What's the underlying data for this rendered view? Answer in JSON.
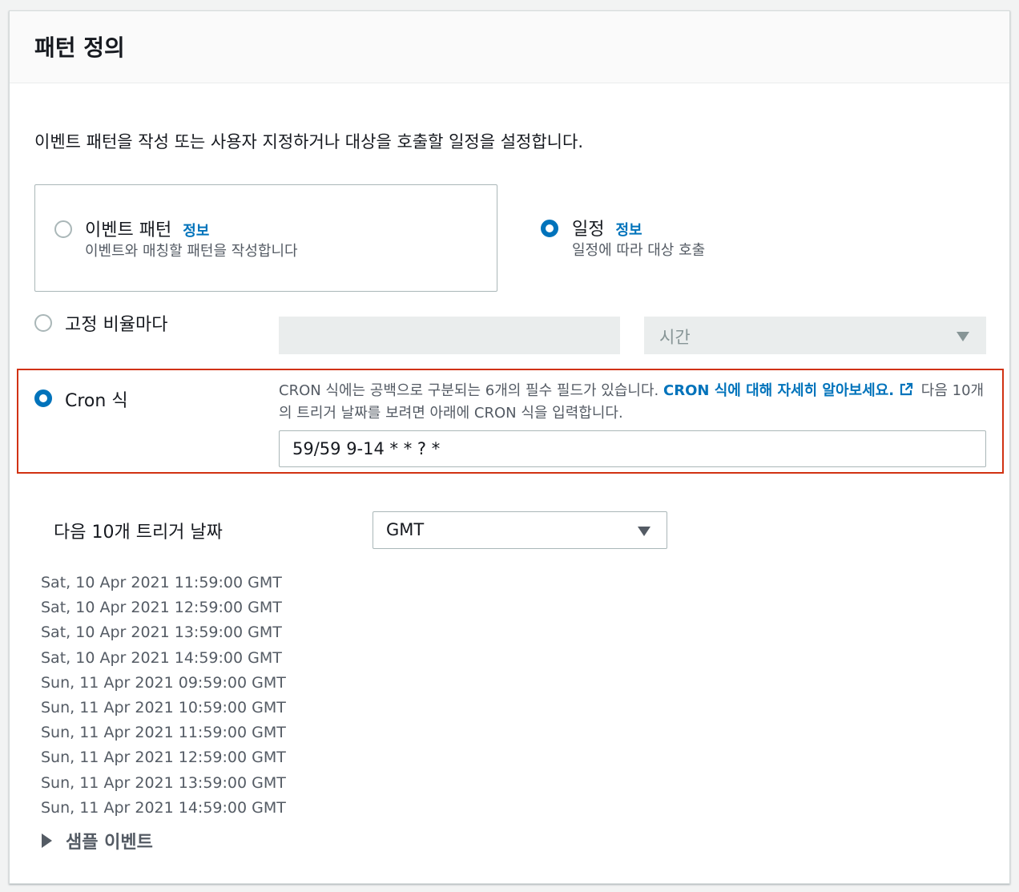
{
  "panel": {
    "title": "패턴 정의",
    "description": "이벤트 패턴을 작성 또는 사용자 지정하거나 대상을 호출할 일정을 설정합니다."
  },
  "pattern_type": {
    "event_pattern": {
      "label": "이벤트 패턴",
      "info": "정보",
      "description": "이벤트와 매칭할 패턴을 작성합니다",
      "selected": false
    },
    "schedule": {
      "label": "일정",
      "info": "정보",
      "description": "일정에 따라 대상 호출",
      "selected": true
    }
  },
  "fixed_rate": {
    "label": "고정 비율마다",
    "value": "",
    "unit_placeholder": "시간",
    "selected": false
  },
  "cron": {
    "label": "Cron 식",
    "selected": true,
    "help_prefix": "CRON 식에는 공백으로 구분되는 6개의 필수 필드가 있습니다.",
    "help_link": "CRON 식에 대해 자세히 알아보세요.",
    "help_suffix": "다음 10개의 트리거 날짜를 보려면 아래에 CRON 식을 입력합니다.",
    "expression": "59/59 9-14 * * ? *"
  },
  "next_triggers": {
    "label": "다음 10개 트리거 날짜",
    "timezone": "GMT",
    "dates": [
      "Sat, 10 Apr 2021 11:59:00 GMT",
      "Sat, 10 Apr 2021 12:59:00 GMT",
      "Sat, 10 Apr 2021 13:59:00 GMT",
      "Sat, 10 Apr 2021 14:59:00 GMT",
      "Sun, 11 Apr 2021 09:59:00 GMT",
      "Sun, 11 Apr 2021 10:59:00 GMT",
      "Sun, 11 Apr 2021 11:59:00 GMT",
      "Sun, 11 Apr 2021 12:59:00 GMT",
      "Sun, 11 Apr 2021 13:59:00 GMT",
      "Sun, 11 Apr 2021 14:59:00 GMT"
    ]
  },
  "sample_events": {
    "label": "샘플 이벤트",
    "expanded": false
  },
  "colors": {
    "accent": "#0073bb",
    "highlight_border": "#d13212",
    "disabled_bg": "#eaeded"
  },
  "icons": {
    "external_link": "external-link-icon",
    "caret": "caret-down-icon",
    "expand": "caret-right-icon"
  }
}
